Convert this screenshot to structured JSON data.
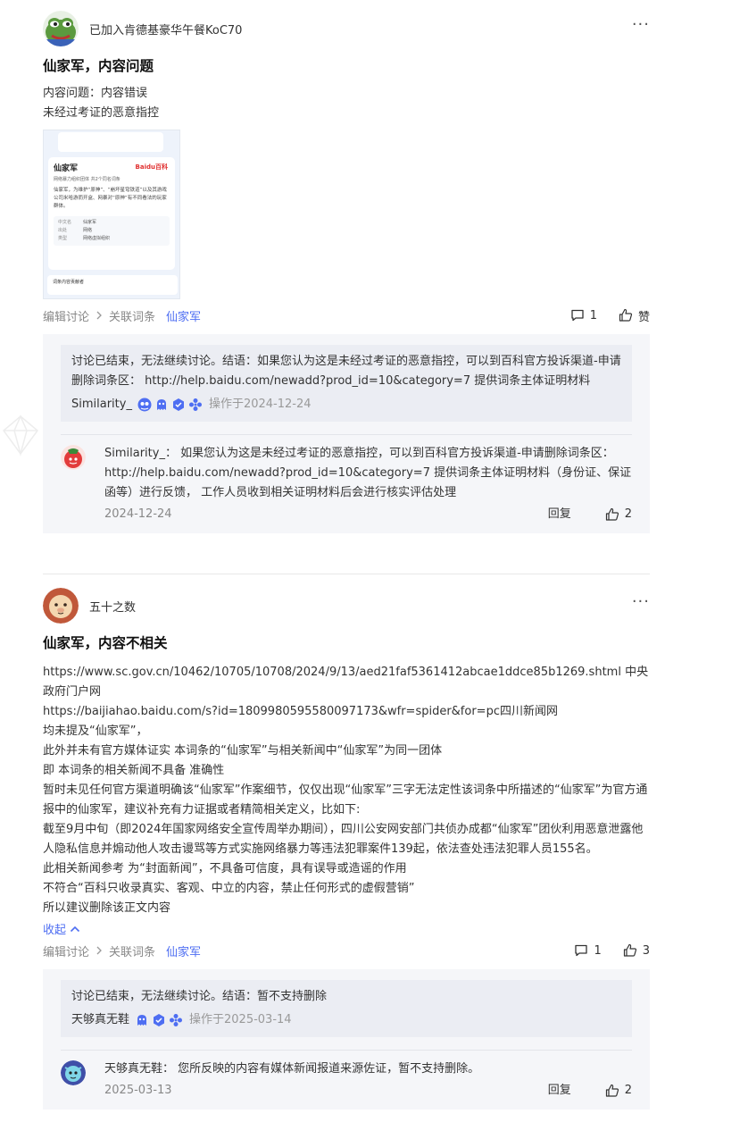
{
  "posts": [
    {
      "author": "已加入肯德基豪华午餐KoC70",
      "more": "···",
      "title": "仙家军，内容问题",
      "body_lines": [
        "内容问题：内容错误",
        "未经过考证的恶意指控"
      ],
      "thumbnail": {
        "entry": "仙家军",
        "logo": "Baidu百科",
        "subtitle": "网络暴力组织团体  共2个同名词条",
        "desc": "仙家军，为维护“原神”、“崩坏星穹铁道”以及其游戏公司米哈游而开盒、网暴对“原神”有不同看法的玩家群体。",
        "kv": [
          {
            "k": "中文名",
            "v": "仙家军"
          },
          {
            "k": "出处",
            "v": "网络"
          },
          {
            "k": "类型",
            "v": "网络虚拟组织"
          }
        ],
        "footer": "词条内容贡献者"
      },
      "meta": {
        "edit_label": "编辑讨论",
        "related_label": "关联词条",
        "entry_link": "仙家军",
        "comment_count": "1",
        "like_label": "赞"
      },
      "conclusion": {
        "text": "讨论已结束，无法继续讨论。结语：如果您认为这是未经过考证的恶意指控，可以到百科官方投诉渠道-申请删除词条区： http://help.baidu.com/newadd?prod_id=10&category=7 提供词条主体证明材料",
        "signer": "Similarity_",
        "op_time": "操作于2024-12-24"
      },
      "reply": {
        "user": "Similarity_：",
        "text": "如果您认为这是未经过考证的恶意指控，可以到百科官方投诉渠道-申请删除词条区： http://help.baidu.com/newadd?prod_id=10&category=7 提供词条主体证明材料（身份证、保证函等）进行反馈， 工作人员收到相关证明材料后会进行核实评估处理",
        "date": "2024-12-24",
        "reply_label": "回复",
        "likes": "2"
      }
    },
    {
      "author": "五十之数",
      "more": "···",
      "title": "仙家军，内容不相关",
      "body_lines": [
        "https://www.sc.gov.cn/10462/10705/10708/2024/9/13/aed21faf5361412abcae1ddce85b1269.shtml 中央政府门户网",
        "https://baijiahao.baidu.com/s?id=1809980595580097173&wfr=spider&for=pc四川新闻网",
        "均未提及“仙家军”，",
        "此外并未有官方媒体证实 本词条的“仙家军”与相关新闻中“仙家军”为同一团体",
        "即 本词条的相关新闻不具备 准确性",
        "暂时未见任何官方渠道明确该“仙家军”作案细节，仅仅出现“仙家军”三字无法定性该词条中所描述的“仙家军”为官方通报中的仙家军，建议补充有力证据或者精简相关定义，比如下:",
        "截至9月中旬（即2024年国家网络安全宣传周举办期间），四川公安网安部门共侦办成都“仙家军”团伙利用恶意泄露他人隐私信息并煽动他人攻击谩骂等方式实施网络暴力等违法犯罪案件139起，依法查处违法犯罪人员155名。",
        "此相关新闻参考 为“封面新闻”，不具备可信度，具有误导或造谣的作用",
        "不符合“百科只收录真实、客观、中立的内容，禁止任何形式的虚假营销”",
        "所以建议删除该正文内容"
      ],
      "collapse_label": "收起",
      "meta": {
        "edit_label": "编辑讨论",
        "related_label": "关联词条",
        "entry_link": "仙家军",
        "comment_count": "1",
        "like_label": "3"
      },
      "conclusion": {
        "text": "讨论已结束，无法继续讨论。结语：暂不支持删除",
        "signer": "天够真无鞋",
        "op_time": "操作于2025-03-14"
      },
      "reply": {
        "user": "天够真无鞋：",
        "text": "您所反映的内容有媒体新闻报道来源佐证，暂不支持删除。",
        "date": "2025-03-13",
        "reply_label": "回复",
        "likes": "2"
      }
    }
  ],
  "colors": {
    "link_blue": "#4e6ef2",
    "panel_bg": "#f5f6f9",
    "conclusion_bg": "#ebedf3",
    "muted": "#888888"
  },
  "icons": [
    "more-icon",
    "comment-icon",
    "thumbs-up-icon",
    "chevron-right-icon",
    "chevron-up-icon",
    "badge-icon"
  ]
}
